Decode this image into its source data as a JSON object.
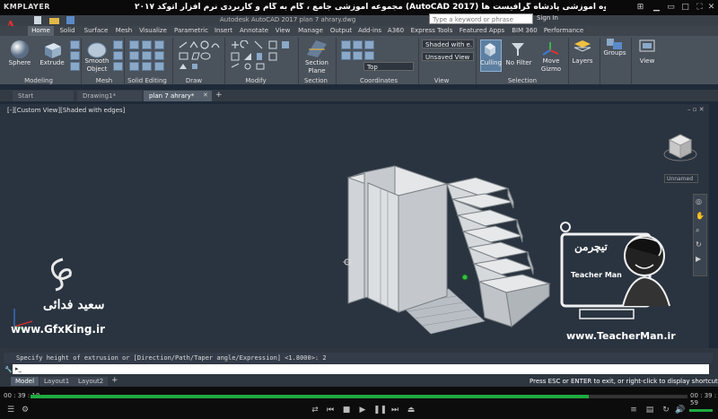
{
  "player": {
    "logo": "KMPLAYER",
    "title": "مجموعه آموزشی جامع ، گام به گام و کاربردی نرم افزار   اتوکد ۲۰۱۷ (AutoCAD 2017)   مدرس : سعید فدائی ( تیچرمن ) گروه آموزشی پادشاه گرافیست ها",
    "time_current": "00 : 39 : 18",
    "time_total": "00 : 39 : 59",
    "progress_fraction": 0.85
  },
  "acad": {
    "title": "Autodesk AutoCAD 2017    plan 7 ahrary.dwg",
    "search_placeholder": "Type a keyword or phrase",
    "signin": "Sign In"
  },
  "ribbon_tabs": [
    "Home",
    "Solid",
    "Surface",
    "Mesh",
    "Visualize",
    "Parametric",
    "Insert",
    "Annotate",
    "View",
    "Manage",
    "Output",
    "Add-ins",
    "A360",
    "Express Tools",
    "Featured Apps",
    "BIM 360",
    "Performance"
  ],
  "ribbon": {
    "buttons": {
      "sphere": "Sphere",
      "extrude": "Extrude",
      "smooth_object": "Smooth Object",
      "section_plane": "Section Plane",
      "culling": "Culling",
      "no_filter": "No Filter",
      "move_gizmo": "Move Gizmo",
      "layers": "Layers",
      "groups": "Groups",
      "view": "View"
    },
    "visual_style": "Shaded with e...",
    "saved_view": "Unsaved View",
    "view_direction": "Top",
    "panels": [
      "Modeling",
      "Mesh",
      "Solid Editing",
      "Draw",
      "Modify",
      "Section",
      "Coordinates",
      "View",
      "Selection"
    ]
  },
  "file_tabs": [
    "Start",
    "Drawing1*",
    "plan 7 ahrary*"
  ],
  "viewport": {
    "label": "[-][Custom View][Shaded with edges]",
    "viewcube_label": "Unnamed"
  },
  "command": {
    "history": "Specify height of extrusion or [Direction/Path/Taper angle/Expression] <1.8000>: 2"
  },
  "layout_tabs": [
    "Model",
    "Layout1",
    "Layout2"
  ],
  "status_message": "Press ESC or ENTER to exit, or right-click to display shortcut-menu.",
  "watermark": {
    "name": "سعید فدائی",
    "url": "www.GfxKing.ir",
    "teacherman_name": "Teacher Man",
    "teacherman_fa": "تیچرمن",
    "teacherman_url": "www.TeacherMan.ir"
  },
  "colors": {
    "accent_red": "#e03030",
    "progress_green": "#1faa40",
    "viewport_bg": "#2a3440"
  }
}
